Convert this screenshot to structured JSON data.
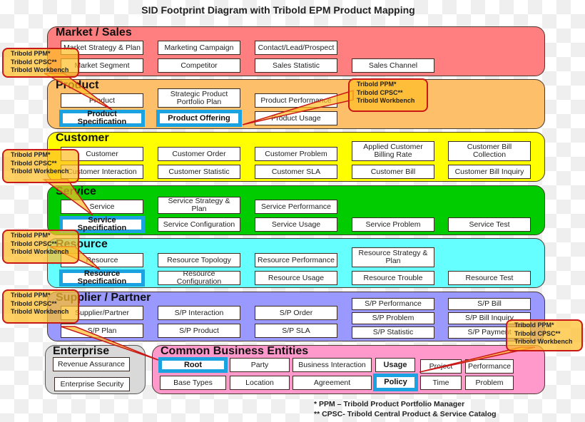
{
  "title": "SID Footprint Diagram with Tribold EPM Product Mapping",
  "colors": {
    "market_sales": "#ff7f80",
    "product": "#fdbf6a",
    "customer": "#ffff00",
    "service": "#00cc00",
    "resource": "#66ffff",
    "supplier_partner": "#9999ff",
    "enterprise": "#d9d9d9",
    "common_business_entities": "#ff99cc",
    "highlight_border": "#1aa3e0",
    "callout_border": "#c81818",
    "callout_fill": "#ffbe28"
  },
  "domains": {
    "market_sales": {
      "label": "Market / Sales",
      "boxes": [
        "Market Strategy & Plan",
        "Marketing Campaign",
        "Contact/Lead/Prospect",
        "Market Segment",
        "Competitor",
        "Sales Statistic",
        "Sales Channel"
      ]
    },
    "product": {
      "label": "Product",
      "boxes": [
        "Product",
        "Strategic Product Portfolio Plan",
        "Product Performance",
        "Product Specification",
        "Product Offering",
        "Product Usage"
      ]
    },
    "customer": {
      "label": "Customer",
      "boxes": [
        "Customer",
        "Customer Order",
        "Customer Problem",
        "Applied Customer Billing Rate",
        "Customer Bill Collection",
        "Customer Interaction",
        "Customer Statistic",
        "Customer SLA",
        "Customer Bill",
        "Customer Bill Inquiry"
      ]
    },
    "service": {
      "label": "Service",
      "boxes": [
        "Service",
        "Service Strategy & Plan",
        "Service Performance",
        "Service Specification",
        "Service Configuration",
        "Service Usage",
        "Service Problem",
        "Service Test"
      ]
    },
    "resource": {
      "label": "Resource",
      "boxes": [
        "Resource",
        "Resource Topology",
        "Resource Performance",
        "Resource Strategy & Plan",
        "Resource Specification",
        "Resource Configuration",
        "Resource Usage",
        "Resource Trouble",
        "Resource Test"
      ]
    },
    "supplier_partner": {
      "label": "Supplier / Partner",
      "boxes": [
        "Supplier/Partner",
        "S/P Interaction",
        "S/P Order",
        "S/P Performance",
        "S/P Bill",
        "S/P Problem",
        "S/P Bill Inquiry",
        "S/P Plan",
        "S/P Product",
        "S/P SLA",
        "S/P Statistic",
        "S/P Payment"
      ]
    },
    "enterprise": {
      "label": "Enterprise",
      "boxes": [
        "Revenue Assurance",
        "Enterprise Security"
      ]
    },
    "common_business_entities": {
      "label": "Common Business Entities",
      "boxes": [
        "Root",
        "Party",
        "Business Interaction",
        "Usage",
        "Project",
        "Performance",
        "Base Types",
        "Location",
        "Agreement",
        "Policy",
        "Time",
        "Problem"
      ]
    }
  },
  "callout": {
    "lines": [
      "Tribold PPM*",
      "Tribold CPSC**",
      "Tribold Workbench"
    ]
  },
  "footnotes": [
    "*   PPM – Tribold Product Portfolio Manager",
    "** CPSC- Tribold Central Product & Service Catalog"
  ]
}
